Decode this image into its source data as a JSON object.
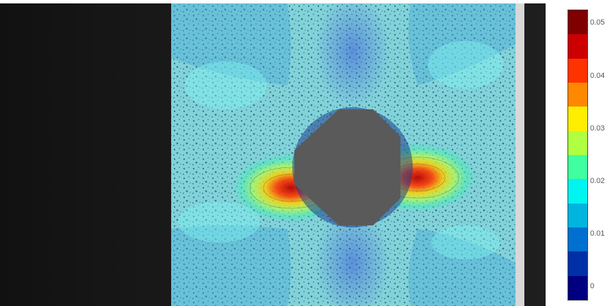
{
  "colorbar": {
    "tick_labels": [
      "0.05",
      "0.04",
      "0.03",
      "0.02",
      "0.01",
      "0"
    ],
    "range": [
      0,
      0.052
    ],
    "colors": [
      "#800000",
      "#cc0000",
      "#ff3300",
      "#ff8800",
      "#ffee00",
      "#b0ff40",
      "#40ffa0",
      "#00f4f0",
      "#00b4e0",
      "#0070d0",
      "#0030a8",
      "#000080"
    ]
  },
  "scene": {
    "description_icon": "strain-field-icon",
    "background_color": "#1a1a1a",
    "specimen_color": "#cfcfcf",
    "hole_color": "#555555"
  }
}
